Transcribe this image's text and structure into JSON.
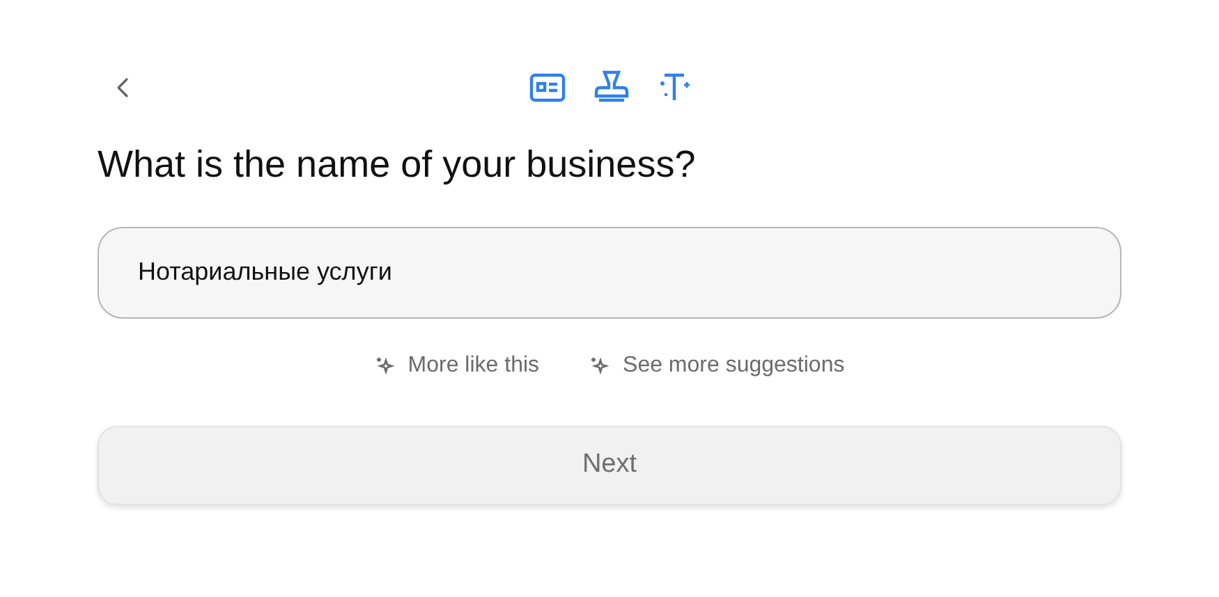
{
  "question": "What is the name of your business?",
  "business_name": {
    "value": "Нотариальные услуги"
  },
  "suggestion_links": [
    "More like this",
    "See more suggestions"
  ],
  "next_button": {
    "label": "Next"
  }
}
